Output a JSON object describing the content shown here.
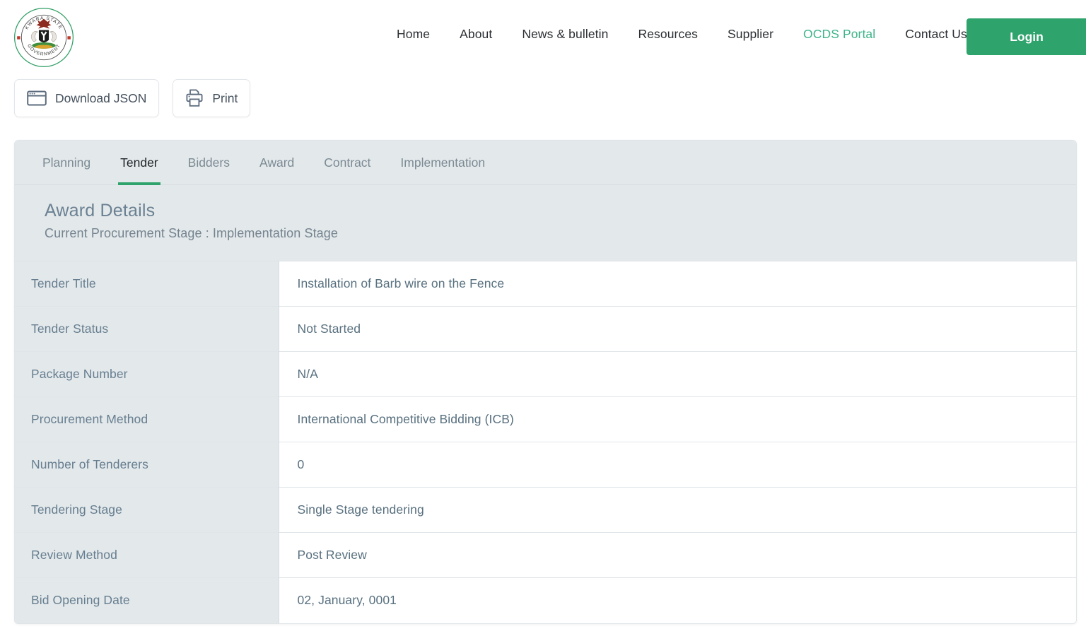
{
  "brand": {
    "seal_top_text": "KWARA STATE",
    "seal_bottom_text": "GOVERNMENT",
    "alt": "Kwara State Government seal"
  },
  "nav": {
    "items": [
      {
        "label": "Home",
        "active": false
      },
      {
        "label": "About",
        "active": false
      },
      {
        "label": "News & bulletin",
        "active": false
      },
      {
        "label": "Resources",
        "active": false
      },
      {
        "label": "Supplier",
        "active": false
      },
      {
        "label": "OCDS Portal",
        "active": true
      },
      {
        "label": "Contact Us",
        "active": false
      }
    ],
    "login_label": "Login"
  },
  "actions": [
    {
      "label": "Download JSON",
      "icon": "browser-window-icon"
    },
    {
      "label": "Print",
      "icon": "printer-icon"
    }
  ],
  "tabs": [
    {
      "label": "Planning",
      "active": false
    },
    {
      "label": "Tender",
      "active": true
    },
    {
      "label": "Bidders",
      "active": false
    },
    {
      "label": "Award",
      "active": false
    },
    {
      "label": "Contract",
      "active": false
    },
    {
      "label": "Implementation",
      "active": false
    }
  ],
  "section": {
    "title": "Award Details",
    "subtitle": "Current Procurement Stage : Implementation Stage"
  },
  "details": [
    {
      "key": "Tender Title",
      "value": "Installation of Barb wire on the Fence"
    },
    {
      "key": "Tender Status",
      "value": "Not Started"
    },
    {
      "key": "Package Number",
      "value": "N/A"
    },
    {
      "key": "Procurement Method",
      "value": "International Competitive Bidding (ICB)"
    },
    {
      "key": "Number of Tenderers",
      "value": "0"
    },
    {
      "key": "Tendering Stage",
      "value": "Single Stage tendering"
    },
    {
      "key": "Review Method",
      "value": "Post Review"
    },
    {
      "key": "Bid Opening Date",
      "value": "02, January, 0001"
    }
  ],
  "colors": {
    "accent_green": "#2ea36b",
    "nav_active_green": "#3eb489",
    "panel_gray": "#e3e8ea",
    "label_text": "#667e90",
    "value_text": "#58707f",
    "border": "#dfe5e8"
  }
}
